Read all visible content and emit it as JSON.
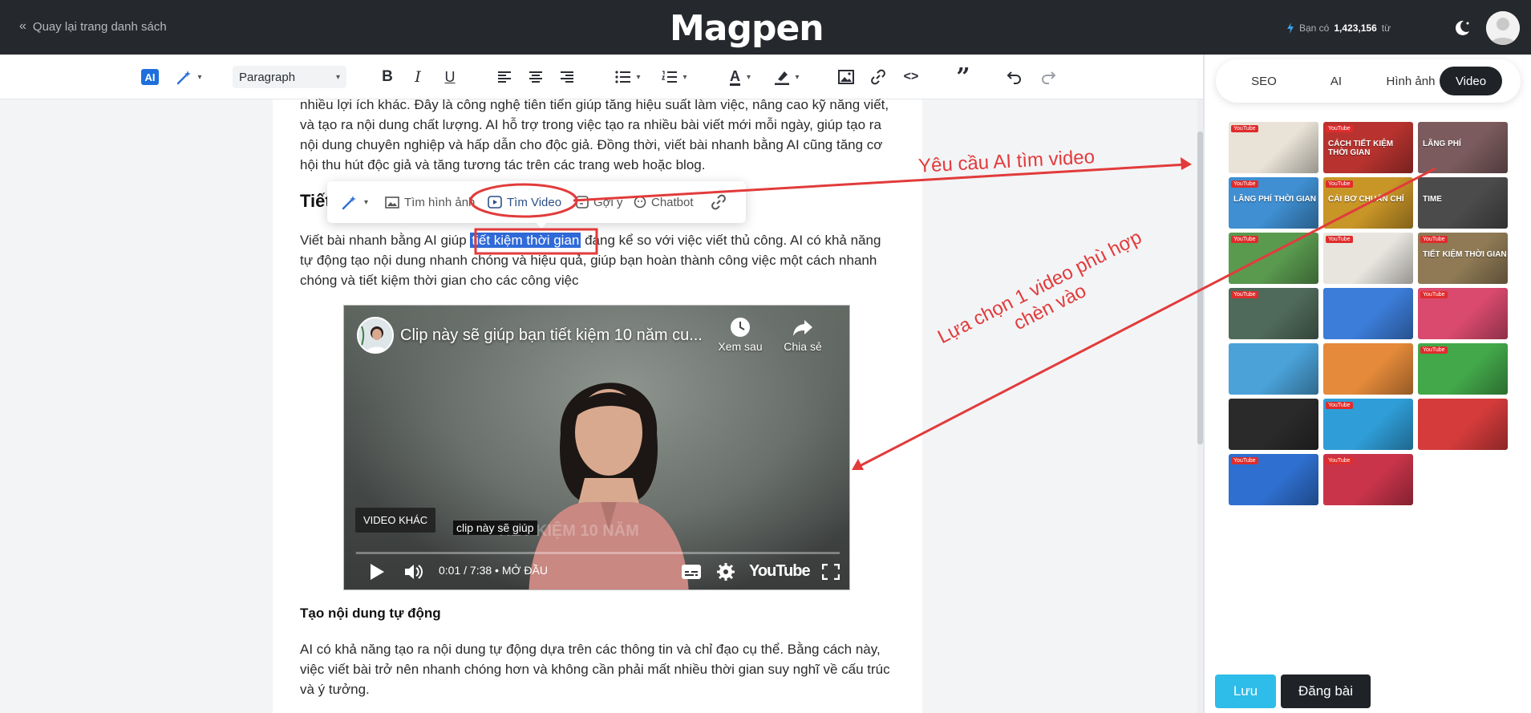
{
  "header": {
    "back_label": "Quay lại trang danh sách",
    "logo": "Magpen",
    "credit_prefix": "Bạn có",
    "credit_value": "1,423,156",
    "credit_suffix": "từ"
  },
  "toolbar": {
    "ai_label": "AI",
    "paragraph_select": "Paragraph",
    "icons": [
      "magic-wand-icon",
      "bold-icon",
      "italic-icon",
      "underline-icon",
      "align-left-icon",
      "align-center-icon",
      "align-right-icon",
      "bullet-list-icon",
      "numbered-list-icon",
      "text-color-icon",
      "highlight-icon",
      "image-icon",
      "link-icon",
      "code-icon",
      "quote-icon",
      "undo-icon",
      "redo-icon"
    ],
    "bold": "B",
    "italic": "I",
    "underline": "U",
    "text_color": "A",
    "code": "<>",
    "quote": "”"
  },
  "editor": {
    "para1": "nhiều lợi ích khác. Đây là công nghệ tiên tiến giúp tăng hiệu suất làm việc, nâng cao kỹ năng viết, và tạo ra nội dung chất lượng. AI hỗ trợ trong việc tạo ra nhiều bài viết mới mỗi ngày, giúp tạo ra nội dung chuyên nghiệp và hấp dẫn cho độc giả. Đồng thời, viết bài nhanh bằng AI cũng tăng cơ hội thu hút độc giả và tăng tương tác trên các trang web hoặc blog.",
    "heading2": "Tiết",
    "para2_before": "Viết bài nhanh bằng AI giúp ",
    "para2_highlight": "tiết kiệm thời gian",
    "para2_after": " đáng kể so với việc viết thủ công. AI có khả năng tự động tạo nội dung nhanh chóng và hiệu quả, giúp bạn hoàn thành công việc một cách nhanh chóng và tiết kiệm thời gian cho các công việc",
    "heading3": "Tạo nội dung tự động",
    "para3": "AI có khả năng tạo ra nội dung tự động dựa trên các thông tin và chỉ đạo cụ thể. Bằng cách này, việc viết bài trở nên nhanh chóng hơn và không cần phải mất nhiều thời gian suy nghĩ về cấu trúc và ý tưởng."
  },
  "popup": {
    "find_image": "Tìm hình ảnh",
    "find_video": "Tìm Video",
    "suggest": "Gợi ý",
    "chatbot": "Chatbot"
  },
  "video": {
    "title": "Clip này sẽ giúp bạn tiết kiệm 10 năm cu...",
    "watch_later": "Xem sau",
    "share": "Chia sẻ",
    "more_videos": "VIDEO KHÁC",
    "caption": "clip này sẽ giúp",
    "overlay_text": "TIẾT KIỆM 10 NĂM",
    "time": "0:01 / 7:38 • MỞ ĐẦU",
    "brand": "YouTube",
    "progress": 0.002
  },
  "right_panel": {
    "tabs": [
      "SEO",
      "AI",
      "Hình ảnh",
      "Video"
    ],
    "active_tab": "Video",
    "thumbnails": [
      {
        "badge": "YouTube",
        "caption": "",
        "bg": "#e9e3d7"
      },
      {
        "badge": "YouTube",
        "caption": "CÁCH TIẾT KIỆM THỜI GIAN",
        "bg": "#b8332f"
      },
      {
        "badge": "",
        "caption": "LÃNG PHÍ",
        "bg": "#7b5b5d"
      },
      {
        "badge": "YouTube",
        "caption": "LÃNG PHÍ THỜI GIAN",
        "bg": "#3f8fd2"
      },
      {
        "badge": "YouTube",
        "caption": "CÁI BƠ CHUẨN CHỈ",
        "bg": "#c89527"
      },
      {
        "badge": "",
        "caption": "TIME",
        "bg": "#4b4b4b"
      },
      {
        "badge": "YouTube",
        "caption": "",
        "bg": "#5a9a4f"
      },
      {
        "badge": "YouTube",
        "caption": "",
        "bg": "#e8e5df"
      },
      {
        "badge": "YouTube",
        "caption": "TIẾT KIỆM THỜI GIAN",
        "bg": "#8f7a55"
      },
      {
        "badge": "YouTube",
        "caption": "",
        "bg": "#4f6a5a"
      },
      {
        "badge": "",
        "caption": "",
        "bg": "#3c7dd9"
      },
      {
        "badge": "YouTube",
        "caption": "",
        "bg": "#d94a6e"
      },
      {
        "badge": "",
        "caption": "",
        "bg": "#4aa2d9"
      },
      {
        "badge": "",
        "caption": "",
        "bg": "#e48a3a"
      },
      {
        "badge": "YouTube",
        "caption": "",
        "bg": "#43a84a"
      },
      {
        "badge": "",
        "caption": "",
        "bg": "#2a2a2a"
      },
      {
        "badge": "YouTube",
        "caption": "",
        "bg": "#2f9ed8"
      },
      {
        "badge": "",
        "caption": "",
        "bg": "#d53b3b"
      },
      {
        "badge": "YouTube",
        "caption": "",
        "bg": "#2f6fd0"
      },
      {
        "badge": "YouTube",
        "caption": "",
        "bg": "#c9344a"
      }
    ],
    "save_button": "Lưu",
    "post_button": "Đăng bài"
  },
  "annotations": {
    "note1": "Yêu cầu AI tìm video",
    "note2_line1": "Lựa chọn 1 video phù hợp",
    "note2_line2": "chèn vào"
  },
  "colors": {
    "topbar": "#25282c",
    "accent_blue": "#1e6fdc",
    "highlight": "#2f6ad8",
    "annotation_red": "#e23b3b",
    "save_button": "#2dbde8",
    "dark_button": "#1f2328"
  }
}
